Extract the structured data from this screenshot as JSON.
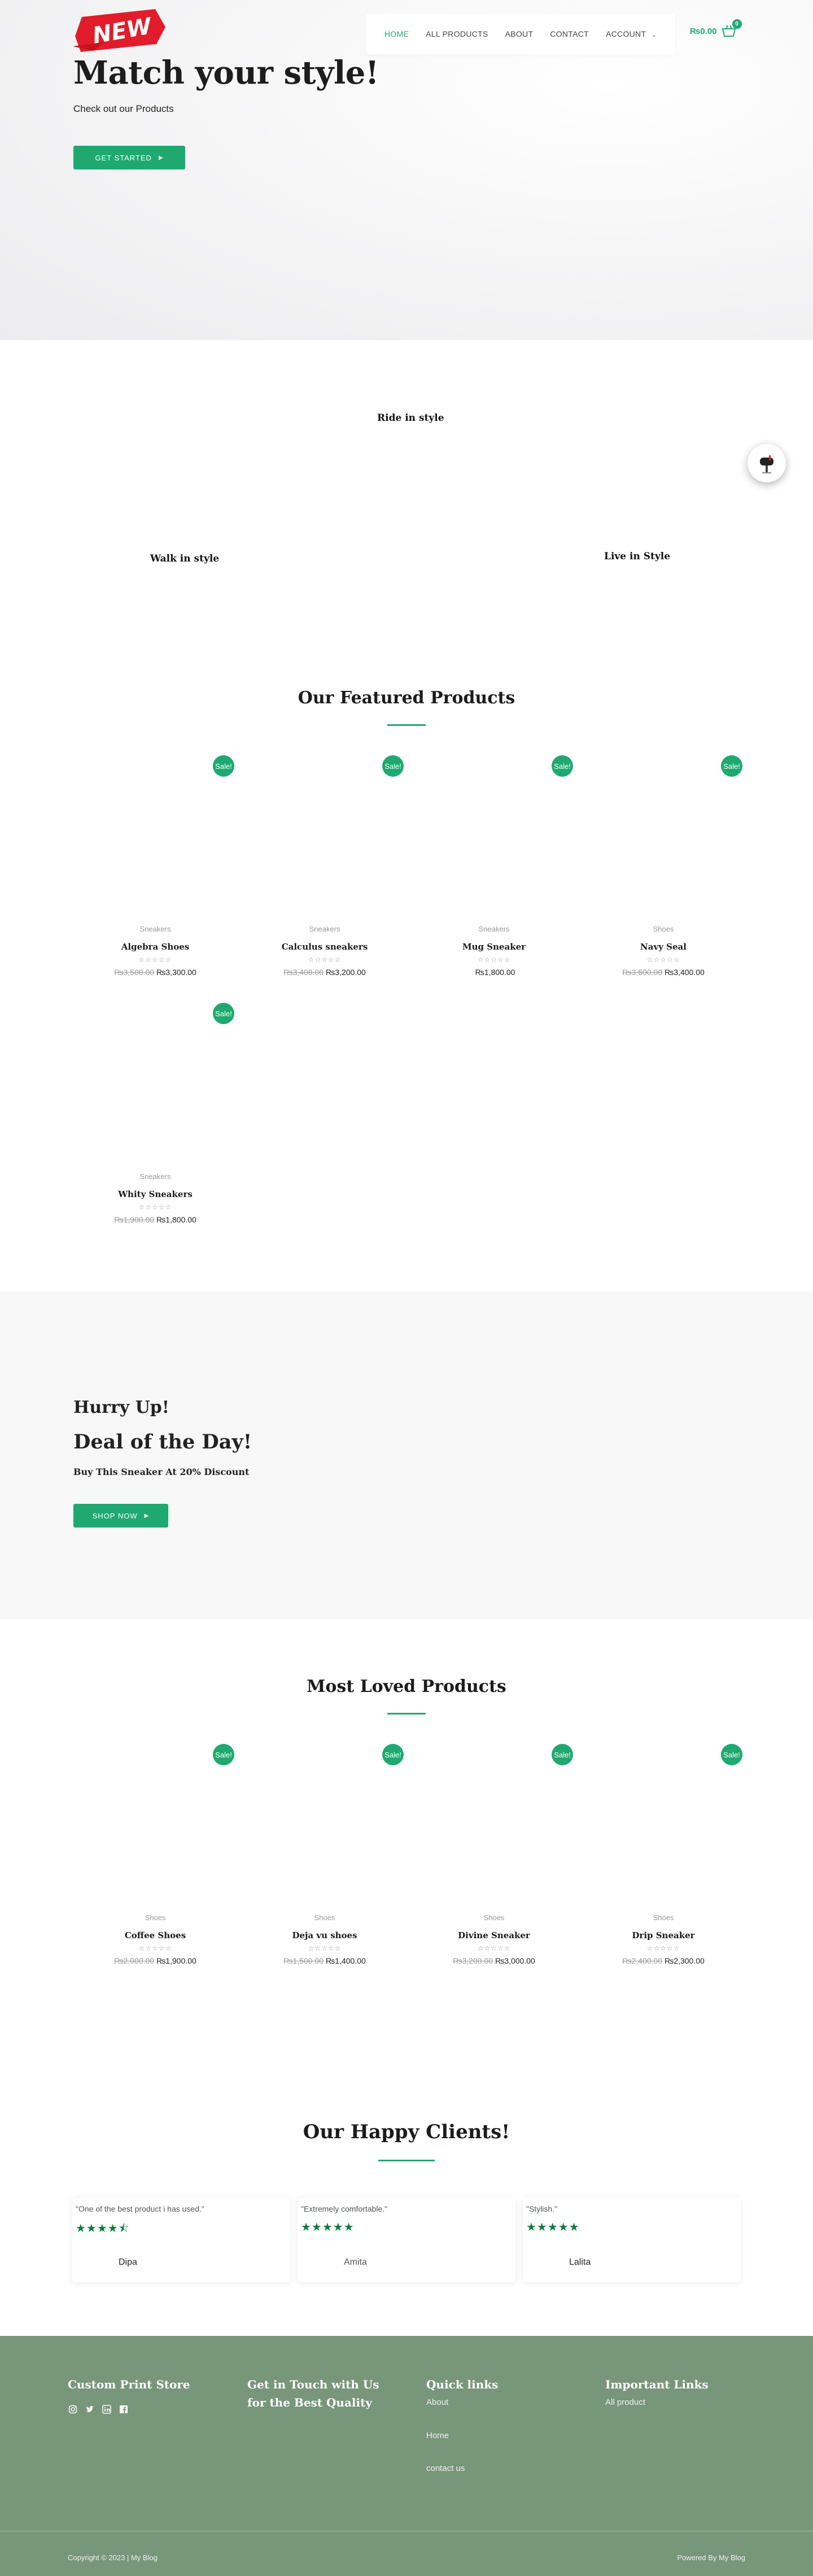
{
  "brand": {
    "logo_text": "NEW",
    "accent": "#1fa971"
  },
  "nav": {
    "items": [
      "HOME",
      "ALL PRODUCTS",
      "ABOUT",
      "CONTACT",
      "ACCOUNT"
    ],
    "cart_total": "₨0.00",
    "cart_count": "0"
  },
  "hero": {
    "title": "Match your style!",
    "subtitle": "Check out our Products",
    "cta": "GET STARTED"
  },
  "categories": {
    "ride": "Ride in style",
    "walk": "Walk in style",
    "live": "Live in Style"
  },
  "featured": {
    "title": "Our Featured Products",
    "products": [
      {
        "category": "Sneakers",
        "name": "Algebra Shoes",
        "old_price": "₨3,500.00",
        "price": "₨3,300.00",
        "sale": "Sale!"
      },
      {
        "category": "Sneakers",
        "name": "Calculus sneakers",
        "old_price": "₨3,400.00",
        "price": "₨3,200.00",
        "sale": "Sale!"
      },
      {
        "category": "Sneakers",
        "name": "Mug Sneaker",
        "old_price": "",
        "price": "₨1,800.00",
        "sale": "Sale!"
      },
      {
        "category": "Shoes",
        "name": "Navy Seal",
        "old_price": "₨3,600.00",
        "price": "₨3,400.00",
        "sale": "Sale!"
      },
      {
        "category": "Sneakers",
        "name": "Whity Sneakers",
        "old_price": "₨1,900.00",
        "price": "₨1,800.00",
        "sale": "Sale!"
      }
    ],
    "stars": "☆☆☆☆☆"
  },
  "deal": {
    "hurry": "Hurry Up!",
    "title": "Deal of the Day!",
    "subtitle": "Buy This Sneaker At 20% Discount",
    "cta": "SHOP NOW"
  },
  "loved": {
    "title": "Most Loved Products",
    "products": [
      {
        "category": "Shoes",
        "name": "Coffee Shoes",
        "old_price": "₨2,000.00",
        "price": "₨1,900.00",
        "sale": "Sale!"
      },
      {
        "category": "Shoes",
        "name": "Deja vu shoes",
        "old_price": "₨1,500.00",
        "price": "₨1,400.00",
        "sale": "Sale!"
      },
      {
        "category": "Shoes",
        "name": "Divine Sneaker",
        "old_price": "₨3,200.00",
        "price": "₨3,000.00",
        "sale": "Sale!"
      },
      {
        "category": "Shoes",
        "name": "Drip Sneaker",
        "old_price": "₨2,400.00",
        "price": "₨2,300.00",
        "sale": "Sale!"
      }
    ]
  },
  "clients": {
    "title": "Our Happy Clients!",
    "reviews": [
      {
        "quote": "\"One of the best product i has used.\"",
        "stars": "★★★★⯪",
        "rating": 4.5,
        "name": "Dipa"
      },
      {
        "quote": "\"Extremely comfortable.\"",
        "stars": "★★★★★",
        "rating": 5,
        "name": "Amita"
      },
      {
        "quote": "\"Stylish.\"",
        "stars": "★★★★★",
        "rating": 5,
        "name": "Lalita"
      }
    ]
  },
  "footer": {
    "store": "Custom Print Store",
    "touch": "Get in Touch with Us for the Best Quality",
    "quick_title": "Quick links",
    "quick_links": [
      "About",
      "Home",
      "contact us"
    ],
    "important_title": "Important Links",
    "important_links": [
      "All product"
    ],
    "copyright": "Copyright © 2023 | My Blog",
    "powered": "Powered By My Blog",
    "social_icons": [
      "instagram-icon",
      "twitter-icon",
      "linkedin-icon",
      "facebook-icon"
    ]
  }
}
